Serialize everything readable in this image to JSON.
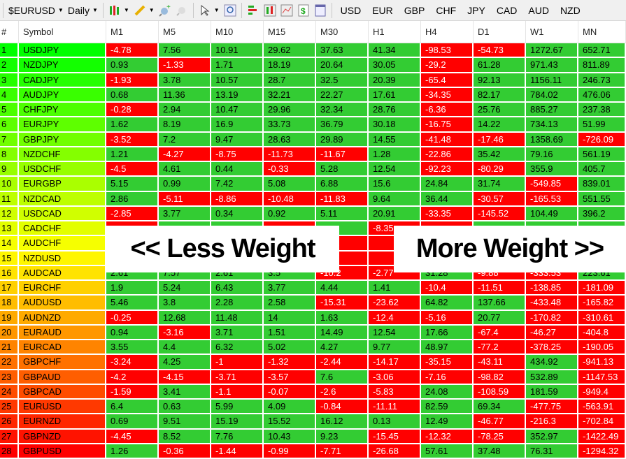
{
  "toolbar": {
    "symbol": "$EURUSD",
    "timeframe": "Daily",
    "currencies": [
      "USD",
      "EUR",
      "GBP",
      "CHF",
      "JPY",
      "CAD",
      "AUD",
      "NZD"
    ]
  },
  "colors": {
    "positive": "#33cc33",
    "negative": "#ff0000"
  },
  "table": {
    "columns": [
      "#",
      "Symbol",
      "M1",
      "M5",
      "M10",
      "M15",
      "M30",
      "H1",
      "H4",
      "D1",
      "W1",
      "MN"
    ],
    "rows": [
      {
        "n": "1",
        "s": "USDJPY",
        "v": [
          "-4.78",
          "7.56",
          "10.91",
          "29.62",
          "37.63",
          "41.34",
          "-98.53",
          "-54.73",
          "1272.67",
          "652.71"
        ]
      },
      {
        "n": "2",
        "s": "NZDJPY",
        "v": [
          "0.93",
          "-1.33",
          "1.71",
          "18.19",
          "20.64",
          "30.05",
          "-29.2",
          "61.28",
          "971.43",
          "811.89"
        ]
      },
      {
        "n": "3",
        "s": "CADJPY",
        "v": [
          "-1.93",
          "3.78",
          "10.57",
          "28.7",
          "32.5",
          "20.39",
          "-65.4",
          "92.13",
          "1156.11",
          "246.73"
        ]
      },
      {
        "n": "4",
        "s": "AUDJPY",
        "v": [
          "0.68",
          "11.36",
          "13.19",
          "32.21",
          "22.27",
          "17.61",
          "-34.35",
          "82.17",
          "784.02",
          "476.06"
        ]
      },
      {
        "n": "5",
        "s": "CHFJPY",
        "v": [
          "-0.28",
          "2.94",
          "10.47",
          "29.96",
          "32.34",
          "28.76",
          "-6.36",
          "25.76",
          "885.27",
          "237.38"
        ]
      },
      {
        "n": "6",
        "s": "EURJPY",
        "v": [
          "1.62",
          "8.19",
          "16.9",
          "33.73",
          "36.79",
          "30.18",
          "-16.75",
          "14.22",
          "734.13",
          "51.99"
        ]
      },
      {
        "n": "7",
        "s": "GBPJPY",
        "v": [
          "-3.52",
          "7.2",
          "9.47",
          "28.63",
          "29.89",
          "14.55",
          "-41.48",
          "-17.46",
          "1358.69",
          "-726.09"
        ]
      },
      {
        "n": "8",
        "s": "NZDCHF",
        "v": [
          "1.21",
          "-4.27",
          "-8.75",
          "-11.73",
          "-11.67",
          "1.28",
          "-22.86",
          "35.42",
          "79.16",
          "561.19"
        ]
      },
      {
        "n": "9",
        "s": "USDCHF",
        "v": [
          "-4.5",
          "4.61",
          "0.44",
          "-0.33",
          "5.28",
          "12.54",
          "-92.23",
          "-80.29",
          "355.9",
          "405.7"
        ]
      },
      {
        "n": "10",
        "s": "EURGBP",
        "v": [
          "5.15",
          "0.99",
          "7.42",
          "5.08",
          "6.88",
          "15.6",
          "24.84",
          "31.74",
          "-549.85",
          "839.01"
        ]
      },
      {
        "n": "11",
        "s": "NZDCAD",
        "v": [
          "2.86",
          "-5.11",
          "-8.86",
          "-10.48",
          "-11.83",
          "9.64",
          "36.44",
          "-30.57",
          "-165.53",
          "551.55"
        ]
      },
      {
        "n": "12",
        "s": "USDCAD",
        "v": [
          "-2.85",
          "3.77",
          "0.34",
          "0.92",
          "5.11",
          "20.91",
          "-33.35",
          "-145.52",
          "104.49",
          "396.2"
        ]
      },
      {
        "n": "13",
        "s": "CADCHF",
        "v": [
          "",
          "",
          "",
          "",
          "",
          "-8.35",
          "",
          "",
          "",
          ""
        ],
        "signs": [
          "r",
          "g",
          "g",
          "r",
          "g",
          "r",
          "r",
          "g",
          "g",
          "g"
        ]
      },
      {
        "n": "14",
        "s": "AUDCHF",
        "v": [
          "",
          "",
          "",
          "",
          "",
          "",
          "",
          "",
          "",
          ""
        ],
        "signs": [
          "g",
          "g",
          "g",
          "g",
          "r",
          "r",
          "g",
          "g",
          "g",
          "g"
        ]
      },
      {
        "n": "15",
        "s": "NZDUSD",
        "v": [
          "",
          "",
          "",
          "",
          "",
          "",
          "",
          "",
          "",
          ""
        ],
        "signs": [
          "g",
          "g",
          "g",
          "g",
          "r",
          "r",
          "g",
          "g",
          "g",
          "g"
        ]
      },
      {
        "n": "16",
        "s": "AUDCAD",
        "v": [
          "2.61",
          "7.57",
          "2.61",
          "3.5",
          "-10.2",
          "-2.77",
          "31.28",
          "-9.88",
          "-333.53",
          "223.61"
        ]
      },
      {
        "n": "17",
        "s": "EURCHF",
        "v": [
          "1.9",
          "5.24",
          "6.43",
          "3.77",
          "4.44",
          "1.41",
          "-10.4",
          "-11.51",
          "-138.85",
          "-181.09"
        ]
      },
      {
        "n": "18",
        "s": "AUDUSD",
        "v": [
          "5.46",
          "3.8",
          "2.28",
          "2.58",
          "-15.31",
          "-23.62",
          "64.82",
          "137.66",
          "-433.48",
          "-165.82"
        ]
      },
      {
        "n": "19",
        "s": "AUDNZD",
        "v": [
          "-0.25",
          "12.68",
          "11.48",
          "14",
          "1.63",
          "-12.4",
          "-5.16",
          "20.77",
          "-170.82",
          "-310.61"
        ]
      },
      {
        "n": "20",
        "s": "EURAUD",
        "v": [
          "0.94",
          "-3.16",
          "3.71",
          "1.51",
          "14.49",
          "12.54",
          "17.66",
          "-67.4",
          "-46.27",
          "-404.8"
        ]
      },
      {
        "n": "21",
        "s": "EURCAD",
        "v": [
          "3.55",
          "4.4",
          "6.32",
          "5.02",
          "4.27",
          "9.77",
          "48.97",
          "-77.2",
          "-378.25",
          "-190.05"
        ]
      },
      {
        "n": "22",
        "s": "GBPCHF",
        "v": [
          "-3.24",
          "4.25",
          "-1",
          "-1.32",
          "-2.44",
          "-14.17",
          "-35.15",
          "-43.11",
          "434.92",
          "-941.13"
        ]
      },
      {
        "n": "23",
        "s": "GBPAUD",
        "v": [
          "-4.2",
          "-4.15",
          "-3.71",
          "-3.57",
          "7.6",
          "-3.06",
          "-7.16",
          "-98.82",
          "532.89",
          "-1147.53"
        ]
      },
      {
        "n": "24",
        "s": "GBPCAD",
        "v": [
          "-1.59",
          "3.41",
          "-1.1",
          "-0.07",
          "-2.6",
          "-5.83",
          "24.08",
          "-108.59",
          "181.59",
          "-949.4"
        ]
      },
      {
        "n": "25",
        "s": "EURUSD",
        "v": [
          "6.4",
          "0.63",
          "5.99",
          "4.09",
          "-0.84",
          "-11.11",
          "82.59",
          "69.34",
          "-477.75",
          "-563.91"
        ]
      },
      {
        "n": "26",
        "s": "EURNZD",
        "v": [
          "0.69",
          "9.51",
          "15.19",
          "15.52",
          "16.12",
          "0.13",
          "12.49",
          "-46.77",
          "-216.3",
          "-702.84"
        ]
      },
      {
        "n": "27",
        "s": "GBPNZD",
        "v": [
          "-4.45",
          "8.52",
          "7.76",
          "10.43",
          "9.23",
          "-15.45",
          "-12.32",
          "-78.25",
          "352.97",
          "-1422.49"
        ]
      },
      {
        "n": "28",
        "s": "GBPUSD",
        "v": [
          "1.26",
          "-0.36",
          "-1.44",
          "-0.99",
          "-7.71",
          "-26.68",
          "57.61",
          "37.48",
          "76.31",
          "-1294.32"
        ]
      }
    ]
  },
  "overlays": {
    "left": "<< Less Weight",
    "right": "More Weight >>"
  }
}
